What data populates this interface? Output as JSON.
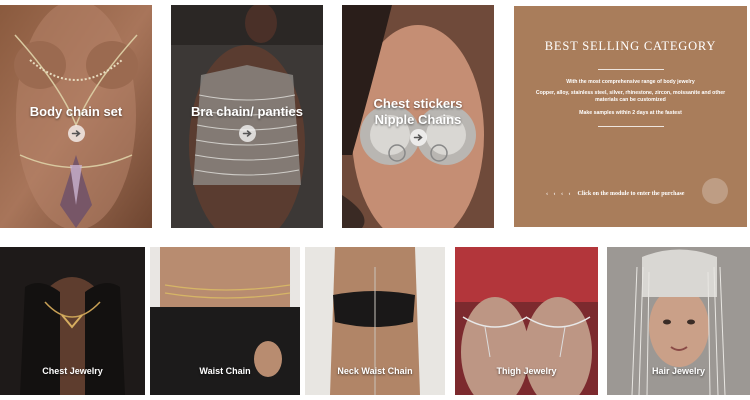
{
  "top_tiles": [
    {
      "label": "Body chain set",
      "icon": "arrow-right-icon"
    },
    {
      "label": "Bra chain/ panties",
      "icon": "arrow-right-icon"
    },
    {
      "label": "Chest stickers\nNipple Chains",
      "icon": "arrow-right-icon"
    }
  ],
  "promo": {
    "title": "BEST SELLING CATEGORY",
    "line1": "With the most comprehensive range of body jewelry",
    "line2": "Copper, alloy, stainless steel, silver, rhinestone, zircon, moissanite and other materials can be customized",
    "line3": "Make samples within 2 days at the fastest",
    "chevrons": "‹ ‹ ‹ ‹",
    "cta": "Click on the module to enter the purchase",
    "bg_color": "#a97d5b"
  },
  "bottom_tiles": [
    {
      "label": "Chest Jewelry"
    },
    {
      "label": "Waist Chain"
    },
    {
      "label": "Neck Waist Chain"
    },
    {
      "label": "Thigh Jewelry"
    },
    {
      "label": "Hair Jewelry"
    }
  ]
}
